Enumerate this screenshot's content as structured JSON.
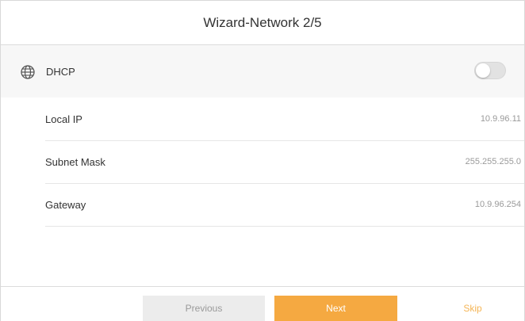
{
  "header": {
    "title": "Wizard-Network 2/5"
  },
  "dhcp": {
    "label": "DHCP",
    "icon": "globe-icon",
    "toggle_on": false
  },
  "fields": [
    {
      "label": "Local IP",
      "value": "10.9.96.11"
    },
    {
      "label": "Subnet Mask",
      "value": "255.255.255.0"
    },
    {
      "label": "Gateway",
      "value": "10.9.96.254"
    }
  ],
  "footer": {
    "previous_label": "Previous",
    "next_label": "Next",
    "skip_label": "Skip"
  },
  "colors": {
    "accent": "#f5a941",
    "skip_text": "#f5b556",
    "previous_bg": "#ececec"
  }
}
